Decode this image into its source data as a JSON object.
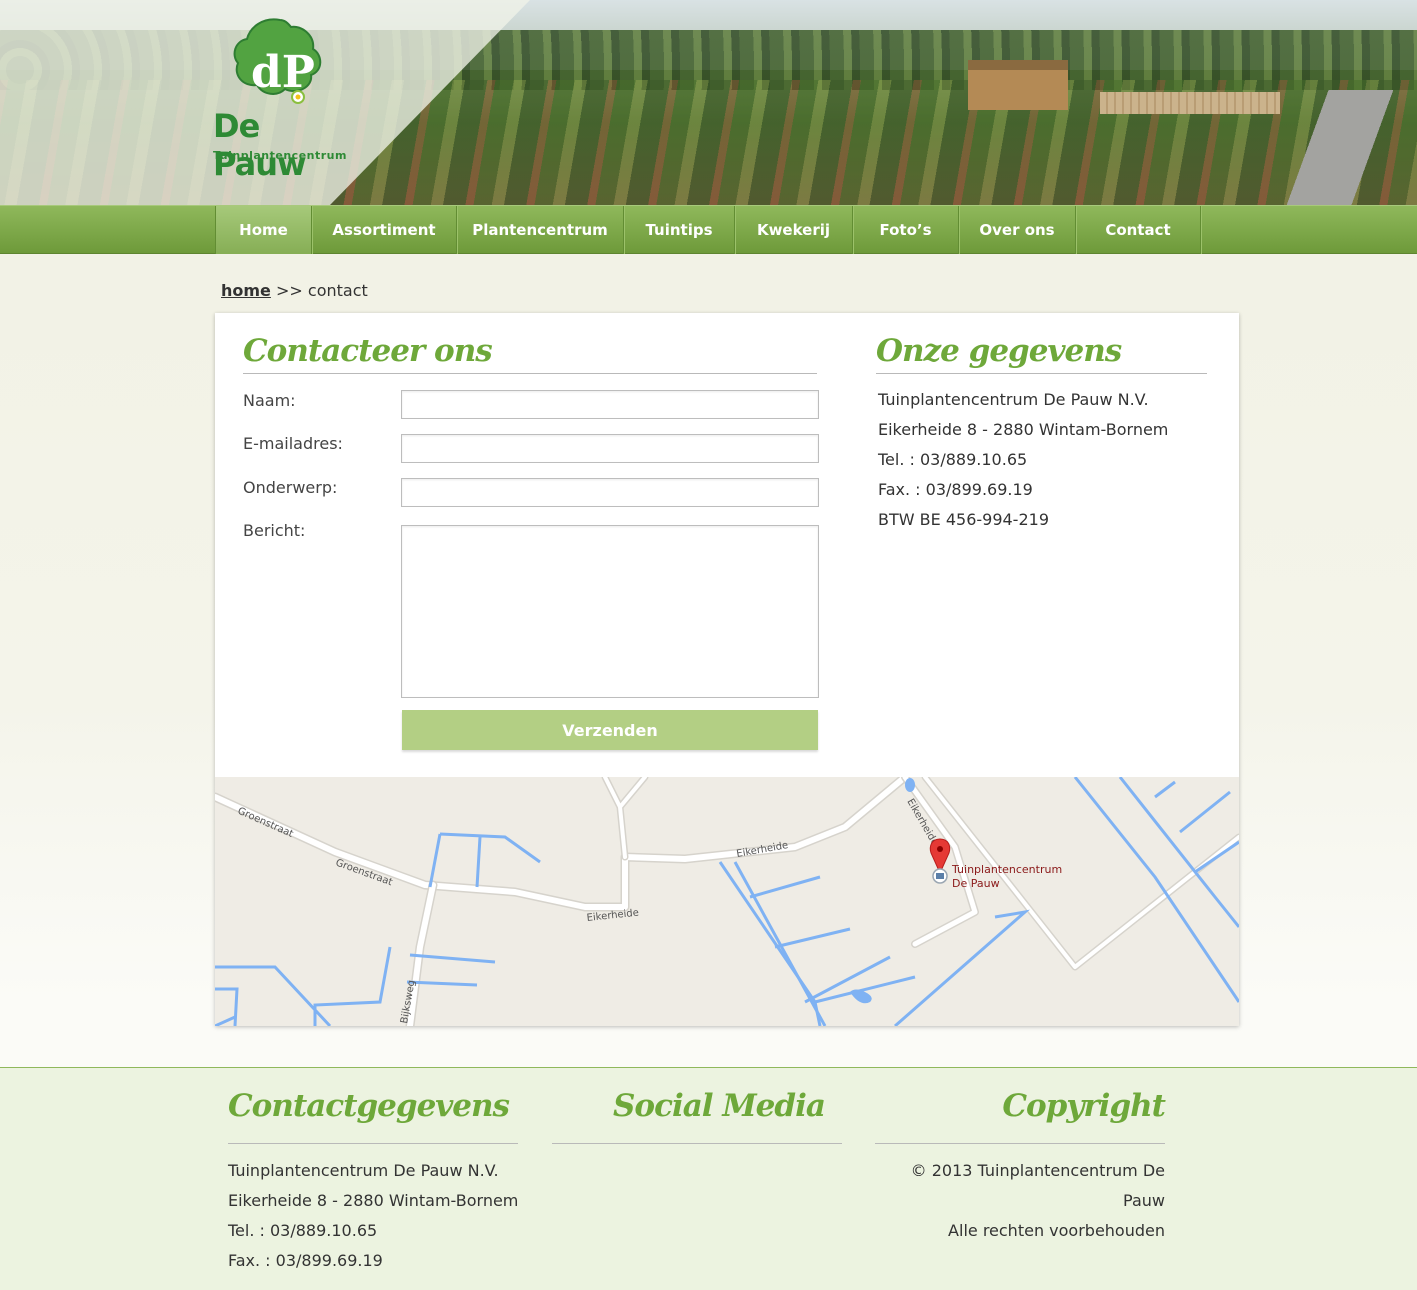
{
  "brand": {
    "logo_monogram": "dP",
    "name": "De Pauw",
    "tagline": "Tuinplantencentrum",
    "color_primary": "#6ea83a",
    "color_nav": "#7aa646"
  },
  "nav": {
    "items": [
      {
        "label": "Home",
        "active": true
      },
      {
        "label": "Assortiment"
      },
      {
        "label": "Plantencentrum"
      },
      {
        "label": "Tuintips"
      },
      {
        "label": "Kwekerij"
      },
      {
        "label": "Foto’s"
      },
      {
        "label": "Over ons"
      },
      {
        "label": "Contact"
      }
    ]
  },
  "breadcrumb": {
    "home": "home",
    "separator": ">>",
    "current": "contact"
  },
  "contact_form": {
    "title": "Contacteer ons",
    "fields": {
      "name_label": "Naam:",
      "email_label": "E-mailadres:",
      "subject_label": "Onderwerp:",
      "message_label": "Bericht:",
      "name_value": "",
      "email_value": "",
      "subject_value": "",
      "message_value": ""
    },
    "submit_label": "Verzenden"
  },
  "company_info": {
    "title": "Onze gegevens",
    "lines": [
      "Tuinplantencentrum De Pauw N.V.",
      "Eikerheide 8 - 2880 Wintam-Bornem",
      "Tel. : 03/889.10.65",
      "Fax. : 03/899.69.19",
      "BTW BE 456-994-219"
    ]
  },
  "map": {
    "marker_label_line1": "Tuinplantencentrum",
    "marker_label_line2": "De Pauw",
    "street_labels": [
      "Groenstraat",
      "Groenstraat",
      "Eikerheide",
      "Eikerheide",
      "Eikerheide",
      "Bijksweg"
    ]
  },
  "footer": {
    "contact": {
      "title": "Contactgegevens",
      "lines": [
        "Tuinplantencentrum De Pauw N.V.",
        "Eikerheide 8 - 2880 Wintam-Bornem",
        "Tel. : 03/889.10.65",
        "Fax. : 03/899.69.19"
      ]
    },
    "social": {
      "title": "Social Media"
    },
    "copyright": {
      "title": "Copyright",
      "lines": [
        "© 2013 Tuinplantencentrum De Pauw",
        "Alle rechten voorbehouden"
      ]
    }
  }
}
